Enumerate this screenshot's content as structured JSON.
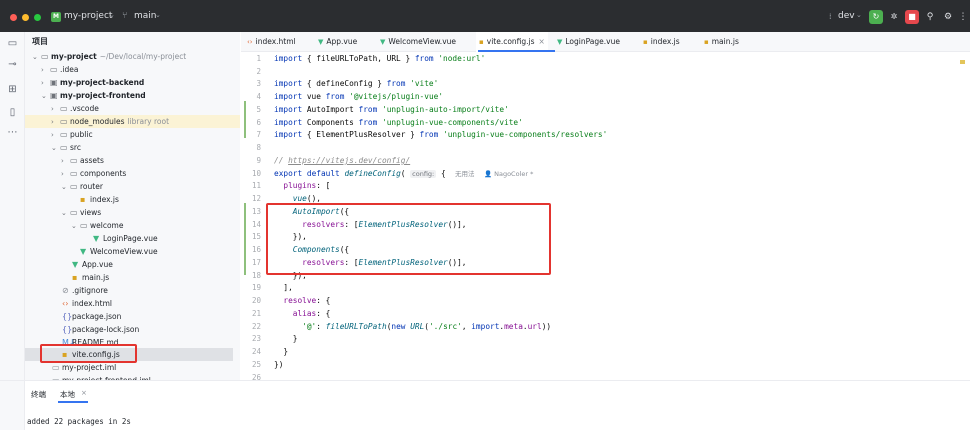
{
  "titlebar": {
    "project_badge": "M",
    "project_name": "my-project",
    "branch_icon": "git-branch-icon",
    "branch": "main",
    "run_config": "dev",
    "controls": [
      "run-icon",
      "debug-icon",
      "stop-icon",
      "search-icon",
      "settings-icon",
      "more-icon"
    ]
  },
  "toolstrip": {
    "items": [
      "folder-icon",
      "commit-icon",
      "structure-icon",
      "bookmarks-icon",
      "more-icon"
    ]
  },
  "project_panel": {
    "title": "项目",
    "rows": [
      {
        "label": "my-project",
        "sub": "~/Dev/local/my-project",
        "icon": "folder-icon",
        "bold": true
      },
      {
        "label": ".idea",
        "sub": "",
        "icon": "folder-icon",
        "bold": false
      },
      {
        "label": "my-project-backend",
        "sub": "",
        "icon": "module-icon",
        "bold": true
      },
      {
        "label": "my-project-frontend",
        "sub": "",
        "icon": "module-icon",
        "bold": true
      },
      {
        "label": ".vscode",
        "sub": "",
        "icon": "folder-icon",
        "bold": false
      },
      {
        "label": "node_modules",
        "sub": "library root",
        "icon": "folder-icon",
        "bold": false
      },
      {
        "label": "public",
        "sub": "",
        "icon": "folder-icon",
        "bold": false
      },
      {
        "label": "src",
        "sub": "",
        "icon": "folder-icon",
        "bold": false
      },
      {
        "label": "assets",
        "sub": "",
        "icon": "folder-icon",
        "bold": false
      },
      {
        "label": "components",
        "sub": "",
        "icon": "folder-icon",
        "bold": false
      },
      {
        "label": "router",
        "sub": "",
        "icon": "folder-icon",
        "bold": false
      },
      {
        "label": "index.js",
        "sub": "",
        "icon": "js-file-icon",
        "bold": false
      },
      {
        "label": "views",
        "sub": "",
        "icon": "folder-icon",
        "bold": false
      },
      {
        "label": "welcome",
        "sub": "",
        "icon": "folder-icon",
        "bold": false
      },
      {
        "label": "LoginPage.vue",
        "sub": "",
        "icon": "vue-file-icon",
        "bold": false
      },
      {
        "label": "WelcomeView.vue",
        "sub": "",
        "icon": "vue-file-icon",
        "bold": false
      },
      {
        "label": "App.vue",
        "sub": "",
        "icon": "vue-file-icon",
        "bold": false
      },
      {
        "label": "main.js",
        "sub": "",
        "icon": "js-file-icon",
        "bold": false
      },
      {
        "label": ".gitignore",
        "sub": "",
        "icon": "gitignore-icon",
        "bold": false
      },
      {
        "label": "index.html",
        "sub": "",
        "icon": "html-file-icon",
        "bold": false
      },
      {
        "label": "package.json",
        "sub": "",
        "icon": "json-file-icon",
        "bold": false
      },
      {
        "label": "package-lock.json",
        "sub": "",
        "icon": "json-file-icon",
        "bold": false
      },
      {
        "label": "README.md",
        "sub": "",
        "icon": "markdown-file-icon",
        "bold": false
      },
      {
        "label": "vite.config.js",
        "sub": "",
        "icon": "js-file-icon",
        "bold": false
      },
      {
        "label": "my-project.iml",
        "sub": "",
        "icon": "iml-file-icon",
        "bold": false
      },
      {
        "label": "my-project-frontend.iml",
        "sub": "",
        "icon": "iml-file-icon",
        "bold": false
      }
    ]
  },
  "tabs": [
    {
      "label": "index.html",
      "icon": "html-file-icon"
    },
    {
      "label": "App.vue",
      "icon": "vue-file-icon"
    },
    {
      "label": "WelcomeView.vue",
      "icon": "vue-file-icon"
    },
    {
      "label": "vite.config.js",
      "icon": "js-file-icon",
      "active": true
    },
    {
      "label": "LoginPage.vue",
      "icon": "vue-file-icon"
    },
    {
      "label": "index.js",
      "icon": "js-file-icon"
    },
    {
      "label": "main.js",
      "icon": "js-file-icon"
    }
  ],
  "editor": {
    "line_numbers": [
      "1",
      "2",
      "3",
      "4",
      "5",
      "6",
      "7",
      "8",
      "9",
      "10",
      "11",
      "12",
      "13",
      "14",
      "15",
      "16",
      "17",
      "18",
      "19",
      "20",
      "21",
      "22",
      "23",
      "24",
      "25",
      "26"
    ],
    "lines": [
      "import { fileURLToPath, URL } from 'node:url'",
      "",
      "import { defineConfig } from 'vite'",
      "import vue from '@vitejs/plugin-vue'",
      "import AutoImport from 'unplugin-auto-import/vite'",
      "import Components from 'unplugin-vue-components/vite'",
      "import { ElementPlusResolver } from 'unplugin-vue-components/resolvers'",
      "",
      "// https://vitejs.dev/config/",
      "export default defineConfig( config: {",
      "  plugins: [",
      "    vue(),",
      "    AutoImport({",
      "      resolvers: [ElementPlusResolver()],",
      "    }),",
      "    Components({",
      "      resolvers: [ElementPlusResolver()],",
      "    }),",
      "  ],",
      "  resolve: {",
      "    alias: {",
      "      '@': fileURLToPath(new URL('./src', import.meta.url))",
      "    }",
      "  }",
      "})",
      ""
    ],
    "inlay_hint": "config:",
    "usages_hint": "无用法",
    "author_hint": "NagoColer *"
  },
  "terminal": {
    "title": "终端",
    "tab_local": "本地",
    "tab_close": "×",
    "output": "added 22 packages in 2s"
  }
}
